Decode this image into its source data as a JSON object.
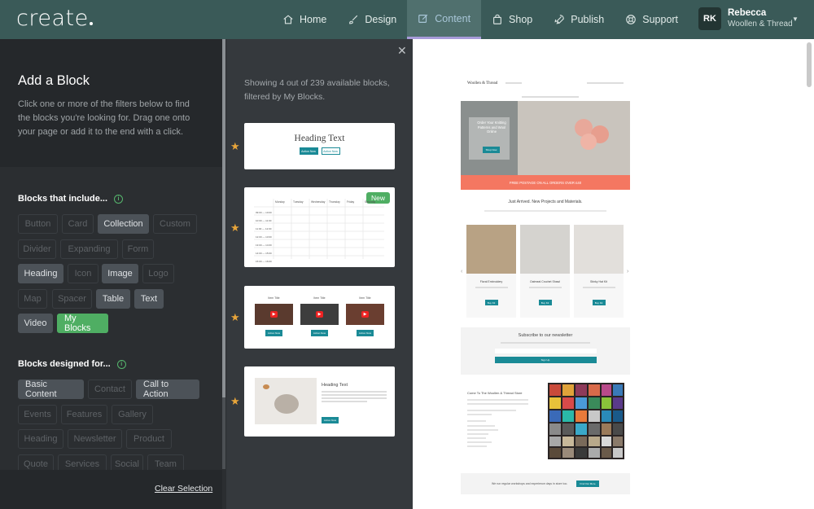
{
  "app": {
    "logo": "create"
  },
  "nav": {
    "items": [
      {
        "label": "Home",
        "icon": "home-icon"
      },
      {
        "label": "Design",
        "icon": "brush-icon"
      },
      {
        "label": "Content",
        "icon": "edit-icon",
        "active": true
      },
      {
        "label": "Shop",
        "icon": "shopping-bag-icon"
      },
      {
        "label": "Publish",
        "icon": "rocket-icon"
      },
      {
        "label": "Support",
        "icon": "lifebuoy-icon"
      }
    ],
    "user": {
      "initials": "RK",
      "name": "Rebecca",
      "site": "Woollen & Thread"
    }
  },
  "panel": {
    "title": "Add a Block",
    "description": "Click one or more of the filters below to find the blocks you're looking for. Drag one onto your page or add it to the end with a click.",
    "include_title": "Blocks that include...",
    "designed_title": "Blocks designed for...",
    "include_filters": [
      {
        "label": "Button",
        "on": false
      },
      {
        "label": "Card",
        "on": false
      },
      {
        "label": "Collection",
        "on": true
      },
      {
        "label": "Custom",
        "on": false
      },
      {
        "label": "Divider",
        "on": false
      },
      {
        "label": "Expanding",
        "on": false
      },
      {
        "label": "Form",
        "on": false
      },
      {
        "label": "Heading",
        "on": true
      },
      {
        "label": "Icon",
        "on": false
      },
      {
        "label": "Image",
        "on": true
      },
      {
        "label": "Logo",
        "on": false
      },
      {
        "label": "Map",
        "on": false
      },
      {
        "label": "Spacer",
        "on": false
      },
      {
        "label": "Table",
        "on": true
      },
      {
        "label": "Text",
        "on": true
      },
      {
        "label": "Video",
        "on": true
      },
      {
        "label": "My Blocks",
        "on": true,
        "green": true
      }
    ],
    "designed_filters": [
      {
        "label": "Basic Content",
        "on": true
      },
      {
        "label": "Contact",
        "on": false
      },
      {
        "label": "Call to Action",
        "on": true
      },
      {
        "label": "Events",
        "on": false
      },
      {
        "label": "Features",
        "on": false
      },
      {
        "label": "Gallery",
        "on": false
      },
      {
        "label": "Heading",
        "on": false
      },
      {
        "label": "Newsletter",
        "on": false
      },
      {
        "label": "Product",
        "on": false
      },
      {
        "label": "Quote",
        "on": false
      },
      {
        "label": "Services",
        "on": false
      },
      {
        "label": "Social",
        "on": false
      },
      {
        "label": "Team",
        "on": false
      }
    ],
    "clear_label": "Clear Selection"
  },
  "results": {
    "status": "Showing 4 out of 239 available blocks, filtered by My Blocks.",
    "new_tag": "New",
    "card1": {
      "heading": "Heading Text",
      "btn1": "Action Now",
      "btn2": "Action Now"
    },
    "card2": {
      "days": [
        "Monday",
        "Tuesday",
        "Wednesday",
        "Thursday",
        "Friday",
        "Saturday"
      ],
      "times": [
        "09:00 — 10:00",
        "10:00 — 11:00",
        "11:00 — 12:00",
        "12:00 — 13:00",
        "13:00 — 14:00",
        "14:00 — 15:00",
        "15:00 — 16:00"
      ]
    },
    "card3": {
      "item_title": "Item Title",
      "btn": "Action Now"
    },
    "card4": {
      "heading": "Heading Text",
      "btn": "Action Now"
    }
  },
  "preview": {
    "brand": "Woollen & Thread",
    "hero_text": "Order Your Knitting Patterns and Wool Online",
    "hero_btn": "Shop Now",
    "banner": "FREE POSTAGE ON ALL ORDERS OVER £40",
    "arrivals_title": "Just Arrived. New Projects and Materials.",
    "products": [
      {
        "name": "Floral Embroidery",
        "btn": "Buy Kit"
      },
      {
        "name": "Oatmeal Crochet Shawl",
        "btn": "Buy Kit"
      },
      {
        "name": "Stinky Hat Kit",
        "btn": "Buy Kit"
      }
    ],
    "newsletter_title": "Subscribe to our newsletter",
    "newsletter_btn": "Sign Up",
    "store_title": "Come To The Woollen & Thread Store",
    "workshop_text": "We run regular workshops and experience days in store too.",
    "workshop_btn": "Find Out More"
  }
}
